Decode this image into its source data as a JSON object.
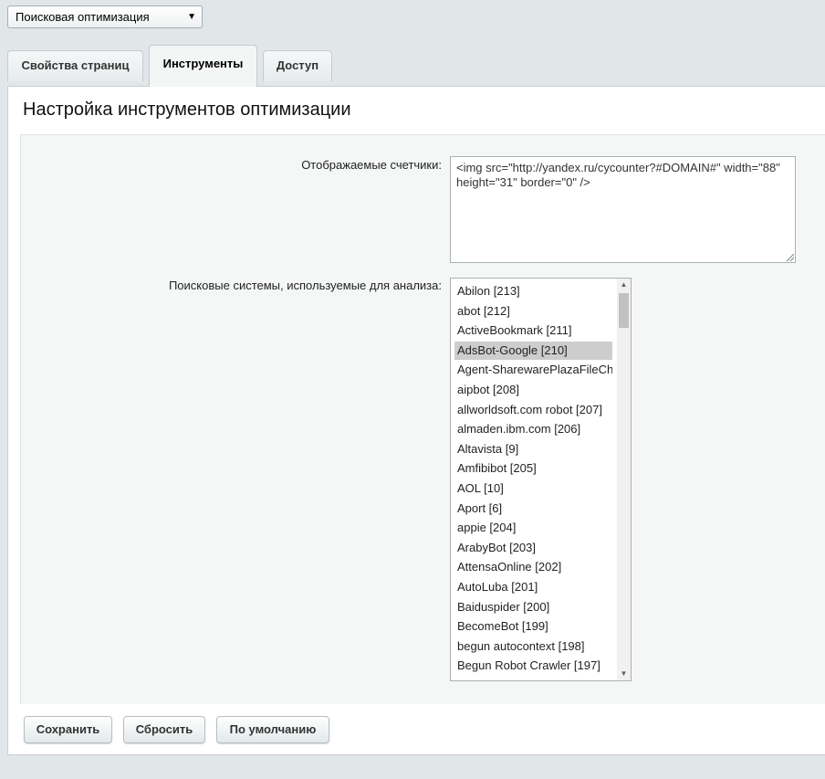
{
  "module_select": {
    "value": "Поисковая оптимизация"
  },
  "tabs": [
    {
      "label": "Свойства страниц"
    },
    {
      "label": "Инструменты"
    },
    {
      "label": "Доступ"
    }
  ],
  "panel": {
    "title": "Настройка инструментов оптимизации"
  },
  "form": {
    "counters_label": "Отображаемые счетчики:",
    "counters_value": "<img src=\"http://yandex.ru/cycounter?#DOMAIN#\" width=\"88\" height=\"31\" border=\"0\" />",
    "engines_label": "Поисковые системы, используемые для анализа:",
    "engines": [
      "Abilon [213]",
      "abot [212]",
      "ActiveBookmark [211]",
      "AdsBot-Google [210]",
      "Agent-SharewarePlazaFileChe",
      "aipbot [208]",
      "allworldsoft.com robot [207]",
      "almaden.ibm.com [206]",
      "Altavista [9]",
      "Amfibibot [205]",
      "AOL [10]",
      "Aport [6]",
      "appie [204]",
      "ArabyBot [203]",
      "AttensaOnline [202]",
      "AutoLuba [201]",
      "Baiduspider [200]",
      "BecomeBot [199]",
      "begun autocontext [198]",
      "Begun Robot Crawler [197]"
    ],
    "selected_engine": "AdsBot-Google [210]"
  },
  "buttons": {
    "save": "Сохранить",
    "reset": "Сбросить",
    "default": "По умолчанию"
  }
}
